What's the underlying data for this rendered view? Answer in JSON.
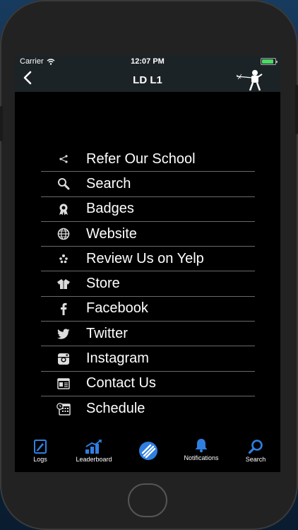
{
  "status": {
    "carrier": "Carrier",
    "time": "12:07 PM",
    "battery_color": "#4cd964"
  },
  "nav": {
    "back": "‹",
    "title": "LD L1"
  },
  "menu": [
    {
      "label": "Refer Our School",
      "icon": "share-icon"
    },
    {
      "label": "Search",
      "icon": "search-icon"
    },
    {
      "label": "Badges",
      "icon": "badge-icon"
    },
    {
      "label": "Website",
      "icon": "globe-icon"
    },
    {
      "label": "Review Us on Yelp",
      "icon": "yelp-icon"
    },
    {
      "label": "Store",
      "icon": "uniform-icon"
    },
    {
      "label": "Facebook",
      "icon": "facebook-icon"
    },
    {
      "label": "Twitter",
      "icon": "twitter-icon"
    },
    {
      "label": "Instagram",
      "icon": "instagram-icon"
    },
    {
      "label": "Contact Us",
      "icon": "contact-card-icon"
    },
    {
      "label": "Schedule",
      "icon": "calendar-clock-icon"
    }
  ],
  "tabs": [
    {
      "label": "Logs",
      "icon": "notebook-icon"
    },
    {
      "label": "Leaderboard",
      "icon": "chart-icon"
    },
    {
      "label": "",
      "icon": "menu-circle-icon"
    },
    {
      "label": "Notifications",
      "icon": "bell-icon"
    },
    {
      "label": "Search",
      "icon": "search-icon"
    }
  ],
  "colors": {
    "accent": "#2f7fe0",
    "screen_bg": "#000000",
    "bar_bg": "#1c2327"
  }
}
